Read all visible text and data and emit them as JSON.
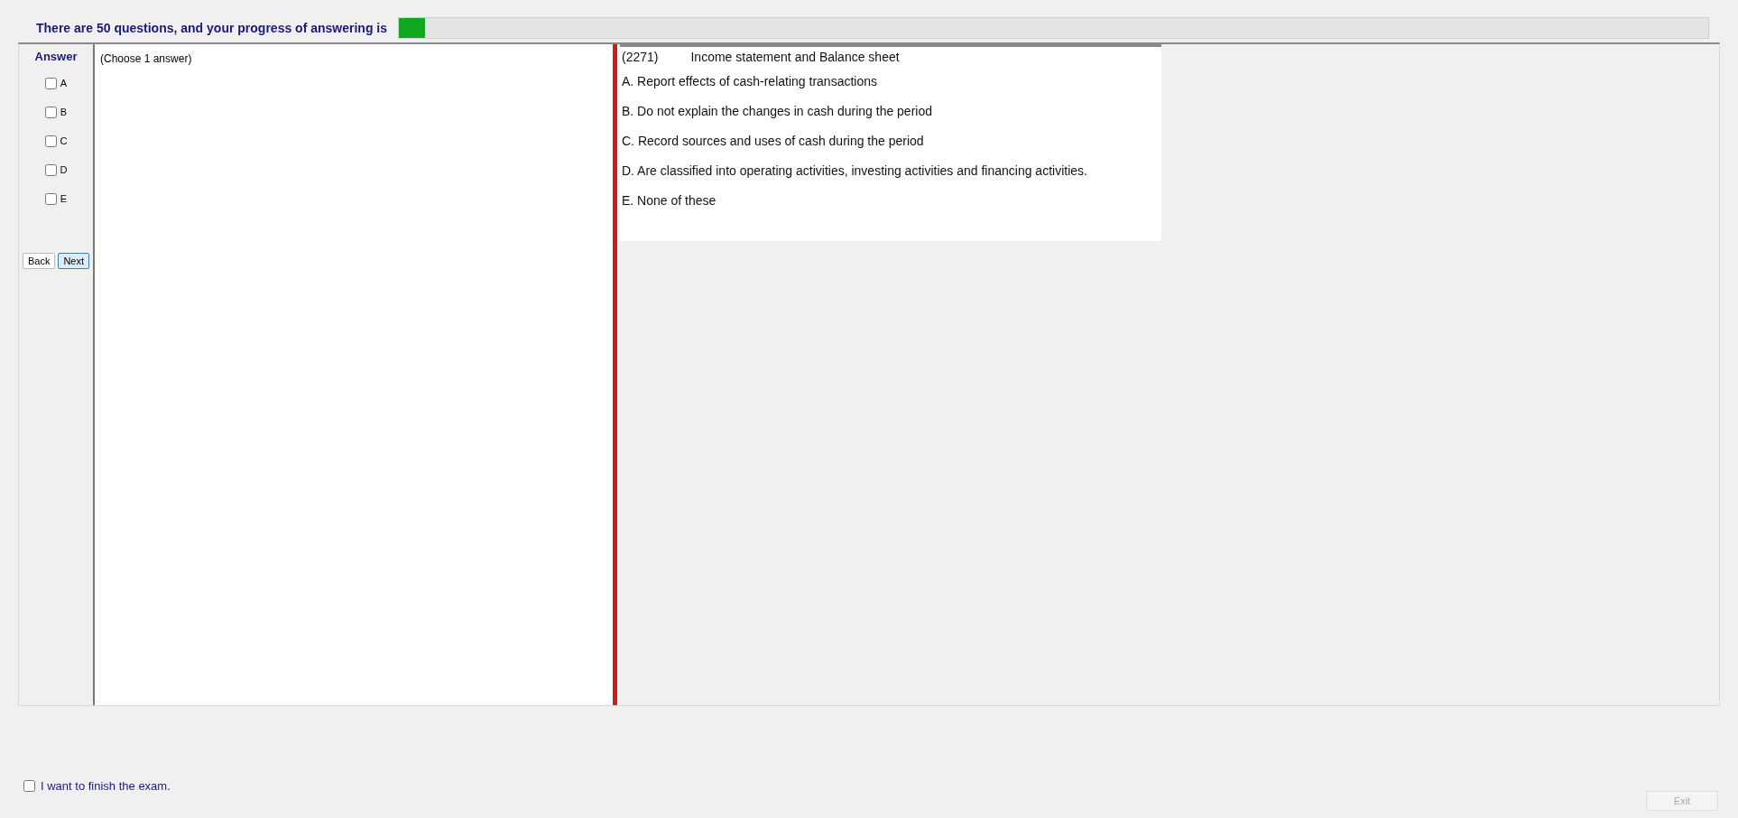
{
  "header": {
    "message": "There are 50 questions, and your progress of answering is",
    "progress": {
      "level": 0.02
    }
  },
  "answer_panel": {
    "title": "Answer",
    "options": [
      {
        "label": "A",
        "checked": false
      },
      {
        "label": "B",
        "checked": false
      },
      {
        "label": "C",
        "checked": false
      },
      {
        "label": "D",
        "checked": false
      },
      {
        "label": "E",
        "checked": false
      }
    ],
    "buttons": [
      {
        "label": "Back",
        "selected": false
      },
      {
        "label": "Next",
        "selected": true
      }
    ]
  },
  "instruction": "(Choose 1 answer)",
  "question": {
    "number": "(2271)",
    "text": "Income statement and Balance sheet",
    "choices": [
      "A.  Report effects of cash-relating transactions",
      "B.  Do not explain the changes in cash during the period",
      "C.  Record sources and uses of cash during the period",
      "D.  Are classified into operating activities, investing activities and financing activities.",
      "E.  None of these"
    ]
  },
  "finish": {
    "label": "I want to finish the exam.",
    "checked": false
  },
  "exit_button": {
    "label": "Exit",
    "disabled": true
  }
}
